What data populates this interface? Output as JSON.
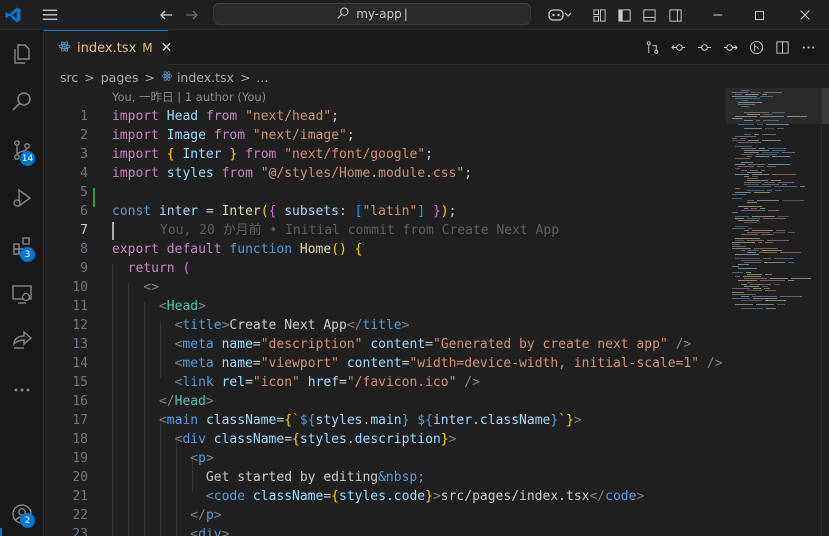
{
  "titlebar": {
    "search_text": "my-app",
    "layout_icons": [
      "copilot-icon",
      "layout-customize-icon",
      "toggle-sidebar-icon",
      "toggle-panel-icon",
      "toggle-secondary-sidebar-icon"
    ]
  },
  "activity_bar": {
    "items": [
      {
        "name": "explorer-icon"
      },
      {
        "name": "search-icon"
      },
      {
        "name": "source-control-icon",
        "badge": "14"
      },
      {
        "name": "run-debug-icon"
      },
      {
        "name": "extensions-icon",
        "badge": "3"
      },
      {
        "name": "remote-explorer-icon"
      },
      {
        "name": "live-share-icon"
      },
      {
        "name": "more-icon"
      }
    ],
    "accounts_badge": "2"
  },
  "tab": {
    "filename": "index.tsx",
    "modified": "M",
    "close": "✕"
  },
  "breadcrumb": {
    "parts": [
      "src",
      ">",
      "pages",
      ">",
      "index.tsx",
      ">",
      "..."
    ]
  },
  "blame": {
    "header": "You, 一昨日 | 1 author (You)",
    "inline": "You, 20 か月前 • Initial commit from Create Next App"
  },
  "editor": {
    "line_numbers": [
      "1",
      "2",
      "3",
      "4",
      "5",
      "6",
      "7",
      "8",
      "9",
      "10",
      "11",
      "12",
      "13",
      "14",
      "15",
      "16",
      "17",
      "18",
      "19",
      "20",
      "21",
      "22",
      "23"
    ],
    "active_line": "7"
  },
  "colors": {
    "accent": "#0078d4",
    "editor_bg": "#1f1f1f",
    "git_added": "#2ea043",
    "keyword": "#569cd6",
    "control": "#c586c0",
    "variable": "#9cdcfe",
    "string": "#ce9178",
    "function": "#dcdcaa"
  }
}
